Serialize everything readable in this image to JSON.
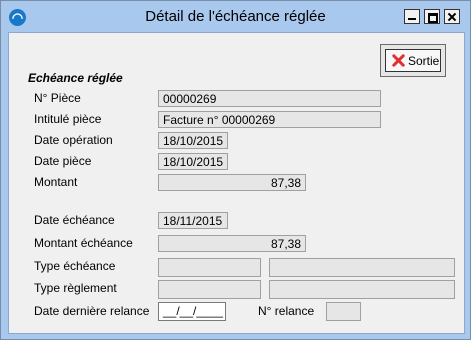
{
  "window": {
    "title": "Détail de l'échéance réglée"
  },
  "toolbar": {
    "sortie_label": "Sortie"
  },
  "section": {
    "title": "Echéance réglée"
  },
  "fields": {
    "numero_piece": {
      "label": "N° Pièce",
      "value": "00000269"
    },
    "intitule_piece": {
      "label": "Intitulé pièce",
      "value": "Facture n° 00000269"
    },
    "date_operation": {
      "label": "Date opération",
      "value": "18/10/2015"
    },
    "date_piece": {
      "label": "Date pièce",
      "value": "18/10/2015"
    },
    "montant": {
      "label": "Montant",
      "value": "87,38"
    },
    "date_echeance": {
      "label": "Date échéance",
      "value": "18/11/2015"
    },
    "montant_echeance": {
      "label": "Montant échéance",
      "value": "87,38"
    },
    "type_echeance": {
      "label": "Type échéance",
      "code": "",
      "libelle": ""
    },
    "type_reglement": {
      "label": "Type règlement",
      "code": "",
      "libelle": ""
    },
    "date_derniere_relance": {
      "label": "Date dernière relance",
      "value": "__/__/____"
    },
    "n_relance": {
      "label": "N° relance",
      "value": ""
    }
  }
}
